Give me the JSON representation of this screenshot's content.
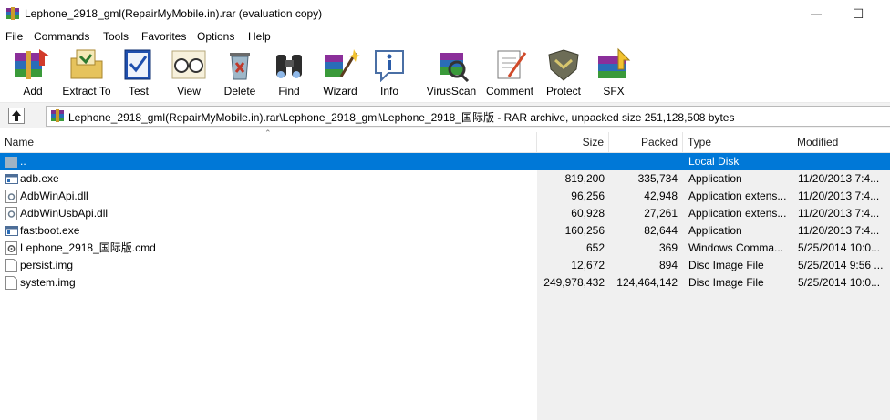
{
  "window": {
    "title": "Lephone_2918_gml(RepairMyMobile.in).rar (evaluation copy)",
    "minimize_glyph": "—",
    "maximize_glyph": "☐"
  },
  "menu": [
    "File",
    "Commands",
    "Tools",
    "Favorites",
    "Options",
    "Help"
  ],
  "toolbar": [
    {
      "label": "Add",
      "icon": "add-archive-icon"
    },
    {
      "label": "Extract To",
      "icon": "extract-folder-icon"
    },
    {
      "label": "Test",
      "icon": "test-book-icon"
    },
    {
      "label": "View",
      "icon": "view-glasses-icon"
    },
    {
      "label": "Delete",
      "icon": "delete-recycle-icon"
    },
    {
      "label": "Find",
      "icon": "find-binoculars-icon"
    },
    {
      "label": "Wizard",
      "icon": "wizard-wand-icon"
    },
    {
      "label": "Info",
      "icon": "info-icon"
    },
    {
      "label": "VirusScan",
      "icon": "virus-scan-icon"
    },
    {
      "label": "Comment",
      "icon": "comment-icon"
    },
    {
      "label": "Protect",
      "icon": "protect-shield-icon"
    },
    {
      "label": "SFX",
      "icon": "sfx-box-icon"
    }
  ],
  "address": {
    "path": "Lephone_2918_gml(RepairMyMobile.in).rar\\Lephone_2918_gml\\Lephone_2918_国际版 - RAR archive, unpacked size 251,128,508 bytes"
  },
  "columns": {
    "name": "Name",
    "size": "Size",
    "packed": "Packed",
    "type": "Type",
    "modified": "Modified"
  },
  "files": [
    {
      "name": "..",
      "size": "",
      "packed": "",
      "type": "Local Disk",
      "modified": "",
      "icon": "parent-folder-icon",
      "selected": true
    },
    {
      "name": "adb.exe",
      "size": "819,200",
      "packed": "335,734",
      "type": "Application",
      "modified": "11/20/2013 7:4...",
      "icon": "exe-icon"
    },
    {
      "name": "AdbWinApi.dll",
      "size": "96,256",
      "packed": "42,948",
      "type": "Application extens...",
      "modified": "11/20/2013 7:4...",
      "icon": "dll-icon"
    },
    {
      "name": "AdbWinUsbApi.dll",
      "size": "60,928",
      "packed": "27,261",
      "type": "Application extens...",
      "modified": "11/20/2013 7:4...",
      "icon": "dll-icon"
    },
    {
      "name": "fastboot.exe",
      "size": "160,256",
      "packed": "82,644",
      "type": "Application",
      "modified": "11/20/2013 7:4...",
      "icon": "exe-icon"
    },
    {
      "name": "Lephone_2918_国际版.cmd",
      "size": "652",
      "packed": "369",
      "type": "Windows Comma...",
      "modified": "5/25/2014 10:0...",
      "icon": "cmd-icon"
    },
    {
      "name": "persist.img",
      "size": "12,672",
      "packed": "894",
      "type": "Disc Image File",
      "modified": "5/25/2014 9:56 ...",
      "icon": "img-file-icon"
    },
    {
      "name": "system.img",
      "size": "249,978,432",
      "packed": "124,464,142",
      "type": "Disc Image File",
      "modified": "5/25/2014 10:0...",
      "icon": "img-file-icon"
    }
  ],
  "colors": {
    "selection": "#0078d7",
    "selection_text": "#ffffff"
  }
}
